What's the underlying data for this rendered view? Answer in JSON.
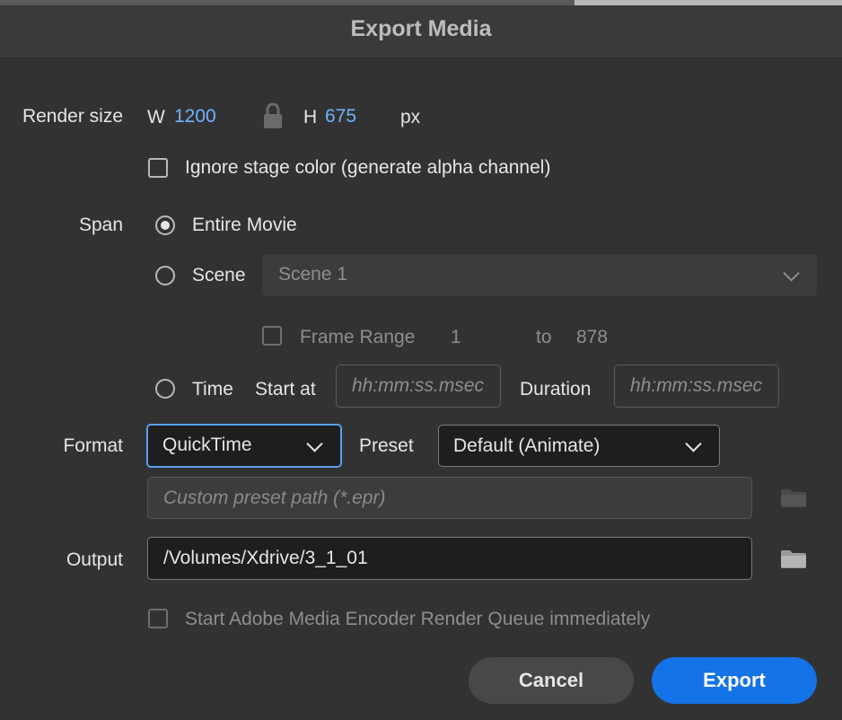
{
  "dialog": {
    "title": "Export Media"
  },
  "render_size": {
    "label": "Render size",
    "w_label": "W",
    "width": "1200",
    "h_label": "H",
    "height": "675",
    "unit": "px",
    "lock_icon": "lock-icon"
  },
  "ignore_stage": {
    "label": "Ignore stage color (generate alpha channel)",
    "checked": false
  },
  "span": {
    "label": "Span",
    "entire_movie": "Entire Movie",
    "scene": "Scene",
    "scene_value": "Scene 1",
    "frame_range": "Frame Range",
    "frame_from": "1",
    "frame_to_label": "to",
    "frame_to": "878",
    "time": "Time",
    "start_at": "Start at",
    "start_placeholder": "hh:mm:ss.msec",
    "duration": "Duration",
    "duration_placeholder": "hh:mm:ss.msec",
    "selected": "Entire Movie"
  },
  "format": {
    "label": "Format",
    "value": "QuickTime",
    "preset_label": "Preset",
    "preset_value": "Default (Animate)",
    "custom_preset_placeholder": "Custom preset path (*.epr)"
  },
  "output": {
    "label": "Output",
    "path": "/Volumes/Xdrive/3_1_01"
  },
  "encoder_queue": {
    "label": "Start Adobe Media Encoder Render Queue immediately",
    "checked": false
  },
  "buttons": {
    "cancel": "Cancel",
    "export": "Export"
  },
  "colors": {
    "background": "#323232",
    "accent": "#1473e6",
    "value_blue": "#6fb2ff",
    "focus_border": "#5aa0f0"
  }
}
